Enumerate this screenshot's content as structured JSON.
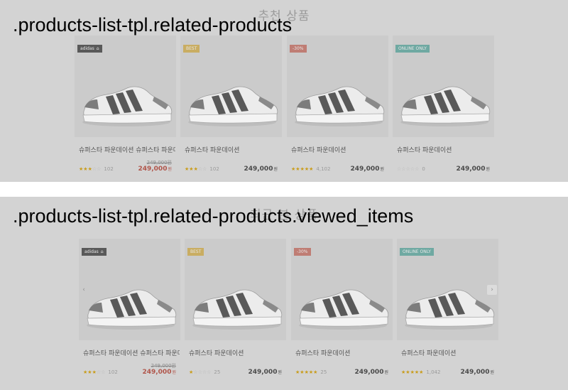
{
  "related": {
    "heading": "추천 상품",
    "overlay": ".products-list-tpl.related-products",
    "items": [
      {
        "badge": "adidas",
        "badge_icon": "tag-icon",
        "badge_type": "brand",
        "name": "슈퍼스타 파운데이션 슈퍼스타 파운데",
        "rating": 2.5,
        "reviews": "102",
        "original_price": "249,000원",
        "price": "249,000",
        "currency": "원",
        "on_sale": true
      },
      {
        "badge": "BEST",
        "badge_type": "best",
        "name": "슈퍼스타 파운데이션",
        "rating": 2.5,
        "reviews": "102",
        "original_price": "",
        "price": "249,000",
        "currency": "원",
        "on_sale": false
      },
      {
        "badge": "-30%",
        "badge_type": "sale",
        "name": "슈퍼스타 파운데이션",
        "rating": 5,
        "reviews": "4,102",
        "original_price": "",
        "price": "249,000",
        "currency": "원",
        "on_sale": false
      },
      {
        "badge": "ONLINE ONLY",
        "badge_type": "online",
        "name": "슈퍼스타 파운데이션",
        "rating": 0,
        "reviews": "0",
        "original_price": "",
        "price": "249,000",
        "currency": "원",
        "on_sale": false
      }
    ]
  },
  "viewed": {
    "heading": "최근 본 상품",
    "overlay": ".products-list-tpl.related-products.viewed_items",
    "prev_icon": "chevron-left-icon",
    "next_icon": "chevron-right-icon",
    "items": [
      {
        "badge": "adidas",
        "badge_icon": "tag-icon",
        "badge_type": "brand",
        "name": "슈퍼스타 파운데이션 슈퍼스타 파운데",
        "rating": 2.5,
        "reviews": "102",
        "original_price": "249,000원",
        "price": "249,000",
        "currency": "원",
        "on_sale": true
      },
      {
        "badge": "BEST",
        "badge_type": "best",
        "name": "슈퍼스타 파운데이션",
        "rating": 1,
        "reviews": "25",
        "original_price": "",
        "price": "249,000",
        "currency": "원",
        "on_sale": false
      },
      {
        "badge": "-30%",
        "badge_type": "sale",
        "name": "슈퍼스타 파운데이션",
        "rating": 4.5,
        "reviews": "25",
        "original_price": "",
        "price": "249,000",
        "currency": "원",
        "on_sale": false
      },
      {
        "badge": "ONLINE ONLY",
        "badge_type": "online",
        "name": "슈퍼스타 파운데이션",
        "rating": 5,
        "reviews": "1,042",
        "original_price": "",
        "price": "249,000",
        "currency": "원",
        "on_sale": false
      }
    ]
  },
  "colors": {
    "star_on": "#c99c1a",
    "star_off": "#b8b8b8",
    "sale_price": "#b0554a"
  }
}
